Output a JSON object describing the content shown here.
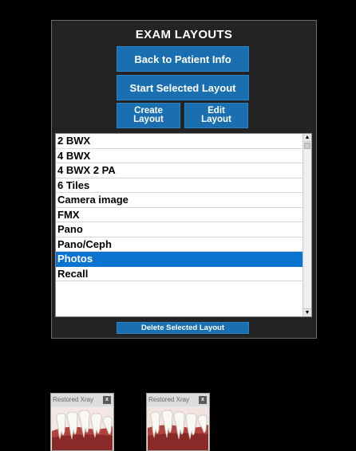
{
  "panel": {
    "title": "EXAM LAYOUTS",
    "back_button": "Back to Patient Info",
    "start_button": "Start Selected Layout",
    "create_button": "Create\nLayout",
    "edit_button": "Edit\nLayout",
    "delete_button": "Delete Selected Layout"
  },
  "layouts": {
    "items": [
      "2 BWX",
      "4 BWX",
      "4 BWX 2 PA",
      "6 Tiles",
      "Camera image",
      "FMX",
      "Pano",
      "Pano/Ceph",
      "Photos",
      "Recall"
    ],
    "selected": "Photos"
  },
  "scrollbar": {
    "up_arrow": "▲",
    "down_arrow": "▼"
  },
  "thumbnails": [
    {
      "title": "Restored Xray",
      "close": "x"
    },
    {
      "title": "Restored Xray",
      "close": "x"
    }
  ],
  "colors": {
    "button": "#1a6fb0",
    "selected": "#0a74d0",
    "panel_bg": "#232323"
  }
}
